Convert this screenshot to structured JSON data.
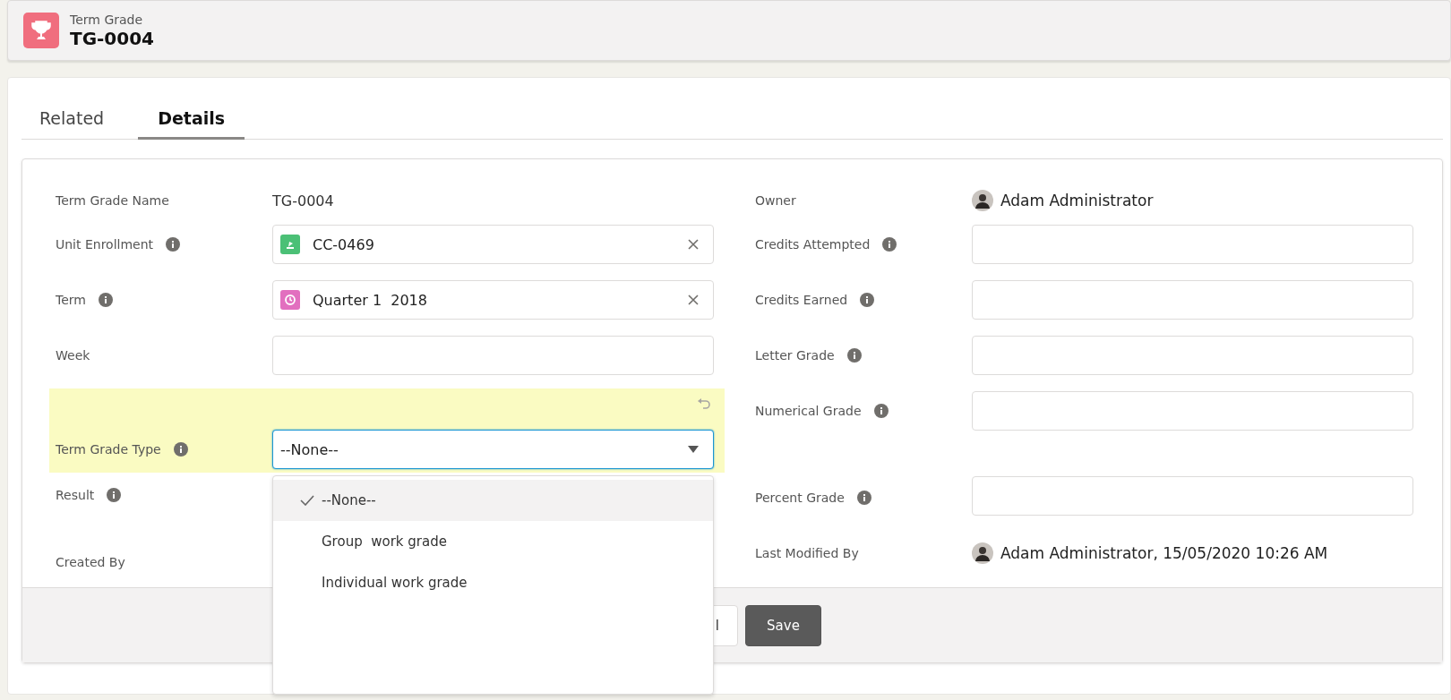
{
  "header": {
    "object_label": "Term Grade",
    "record_name": "TG-0004"
  },
  "tabs": [
    {
      "label": "Related",
      "selected": false
    },
    {
      "label": "Details",
      "selected": true
    }
  ],
  "left_fields": [
    {
      "kind": "text",
      "label": "Term Grade Name",
      "info": false,
      "value": "TG-0004"
    },
    {
      "kind": "lookup",
      "label": "Unit Enrollment",
      "info": true,
      "value": "CC-0469",
      "color": "#4bc076"
    },
    {
      "kind": "lookup",
      "label": "Term",
      "info": true,
      "value": "Quarter 1  2018",
      "color": "#e26fbf"
    },
    {
      "kind": "input",
      "label": "Week",
      "info": false
    },
    {
      "kind": "picklist",
      "label": "Term Grade Type",
      "info": true,
      "value": "--None--",
      "edited": true,
      "expanded": true,
      "options": [
        {
          "label": "--None--",
          "selected": true
        },
        {
          "label": "Group  work grade",
          "selected": false
        },
        {
          "label": "Individual work grade",
          "selected": false
        }
      ]
    },
    {
      "kind": "label",
      "label": "Result",
      "info": true
    },
    {
      "kind": "label",
      "label": "Created By",
      "info": false
    }
  ],
  "right_fields": [
    {
      "kind": "user",
      "label": "Owner",
      "info": false,
      "value": "Adam Administrator"
    },
    {
      "kind": "input",
      "label": "Credits Attempted",
      "info": true
    },
    {
      "kind": "input",
      "label": "Credits Earned",
      "info": true
    },
    {
      "kind": "input",
      "label": "Letter Grade",
      "info": true
    },
    {
      "kind": "input",
      "label": "Numerical Grade",
      "info": true
    },
    {
      "kind": "input",
      "label": "Percent Grade",
      "info": true
    },
    {
      "kind": "user",
      "label": "Last Modified By",
      "info": false,
      "value": "Adam Administrator, 15/05/2020 10:26 AM"
    }
  ],
  "footer_buttons": [
    {
      "kind": "neutral",
      "label": "l"
    },
    {
      "kind": "brand",
      "label": "Save"
    }
  ]
}
